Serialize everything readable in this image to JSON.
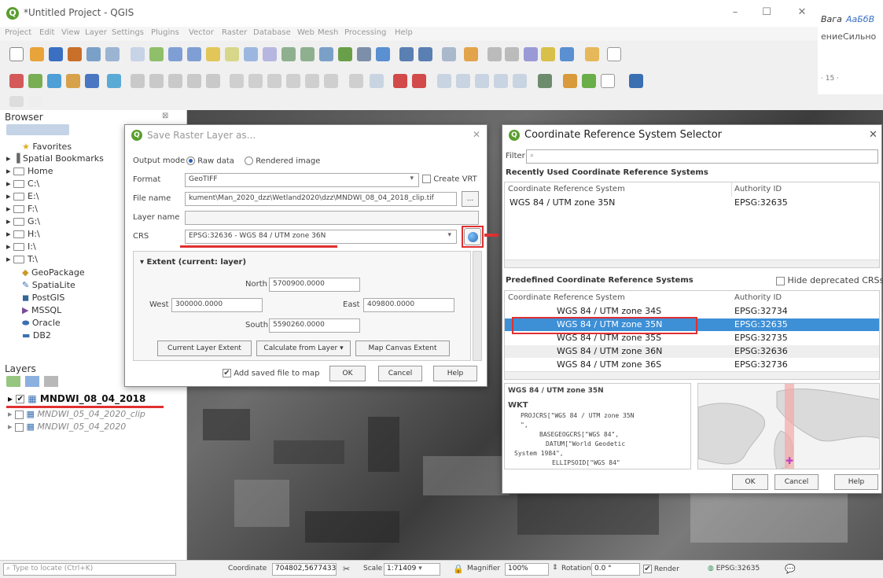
{
  "window": {
    "title": "*Untitled Project - QGIS",
    "minimize": "–",
    "maximize": "☐",
    "close": "✕"
  },
  "outside": {
    "line1a": "Вага",
    "line1b": "АаБбВ",
    "line2a": "ение",
    "line2b": "Сильно",
    "ruler": "· 15 ·"
  },
  "menu": [
    "Project",
    "Edit",
    "View",
    "Layer",
    "Settings",
    "Plugins",
    "Vector",
    "Raster",
    "Database",
    "Web",
    "Mesh",
    "Processing",
    "Help"
  ],
  "browser": {
    "title": "Browser",
    "items": [
      "Favorites",
      "Spatial Bookmarks",
      "Home",
      "C:\\",
      "E:\\",
      "F:\\",
      "G:\\",
      "H:\\",
      "I:\\",
      "T:\\",
      "GeoPackage",
      "SpatiaLite",
      "PostGIS",
      "MSSQL",
      "Oracle",
      "DB2"
    ]
  },
  "layers": {
    "title": "Layers",
    "items": [
      {
        "name": "MNDWI_08_04_2018",
        "checked": true
      },
      {
        "name": "MNDWI_05_04_2020_clip",
        "checked": false
      },
      {
        "name": "MNDWI_05_04_2020",
        "checked": false
      }
    ]
  },
  "save_dialog": {
    "title": "Save Raster Layer as...",
    "output_mode_label": "Output mode",
    "raw_data": "Raw data",
    "rendered_image": "Rendered image",
    "format_label": "Format",
    "format_value": "GeoTIFF",
    "create_vrt": "Create VRT",
    "file_name_label": "File name",
    "file_name_value": "kument\\Man_2020_dzz\\Wetland2020\\dzz\\MNDWI_08_04_2018_clip.tif",
    "browse_button": "...",
    "layer_name_label": "Layer name",
    "layer_name_value": "",
    "crs_label": "CRS",
    "crs_value": "EPSG:32636 - WGS 84 / UTM zone 36N",
    "extent_title": "Extent (current: layer)",
    "north_label": "North",
    "north_value": "5700900.0000",
    "west_label": "West",
    "west_value": "300000.0000",
    "east_label": "East",
    "east_value": "409800.0000",
    "south_label": "South",
    "south_value": "5590260.0000",
    "current_layer_extent": "Current Layer Extent",
    "calculate_from_layer": "Calculate from Layer",
    "map_canvas_extent": "Map Canvas Extent",
    "add_saved_file": "Add saved file to map",
    "ok": "OK",
    "cancel": "Cancel",
    "help": "Help"
  },
  "crs_dialog": {
    "title": "Coordinate Reference System Selector",
    "filter_label": "Filter",
    "recent_title": "Recently Used Coordinate Reference Systems",
    "col_crs": "Coordinate Reference System",
    "col_auth": "Authority ID",
    "recent_rows": [
      {
        "crs": "WGS 84 / UTM zone 35N",
        "auth": "EPSG:32635"
      }
    ],
    "predefined_title": "Predefined Coordinate Reference Systems",
    "hide_deprecated": "Hide deprecated CRSs",
    "predefined_rows": [
      {
        "crs": "WGS 84 / UTM zone 34S",
        "auth": "EPSG:32734",
        "selected": false
      },
      {
        "crs": "WGS 84 / UTM zone 35N",
        "auth": "EPSG:32635",
        "selected": true
      },
      {
        "crs": "WGS 84 / UTM zone 35S",
        "auth": "EPSG:32735",
        "selected": false
      },
      {
        "crs": "WGS 84 / UTM zone 36N",
        "auth": "EPSG:32636",
        "selected": false
      },
      {
        "crs": "WGS 84 / UTM zone 36S",
        "auth": "EPSG:32736",
        "selected": false
      }
    ],
    "selected_name": "WGS 84 / UTM zone 35N",
    "wkt_label": "WKT",
    "wkt_lines": [
      "PROJCRS[\"WGS 84 / UTM zone 35N",
      "\",",
      "    BASEGEOGCRS[\"WGS 84\",",
      "        DATUM[\"World Geodetic",
      "System 1984\",",
      "            ELLIPSOID[\"WGS 84\""
    ],
    "ok": "OK",
    "cancel": "Cancel",
    "help": "Help"
  },
  "status": {
    "locate_placeholder": "Type to locate (Ctrl+K)",
    "coordinate_label": "Coordinate",
    "coordinate_value": "704802,5677433",
    "scale_label": "Scale",
    "scale_value": "1:71409",
    "magnifier_label": "Magnifier",
    "magnifier_value": "100%",
    "rotation_label": "Rotation",
    "rotation_value": "0.0 °",
    "render_label": "Render",
    "crs_value": "EPSG:32635"
  },
  "colors": {
    "accent": "#3178c6",
    "selection": "#3d8fd6",
    "annotation": "#e03030",
    "qgis_green": "#5a9e2f"
  }
}
